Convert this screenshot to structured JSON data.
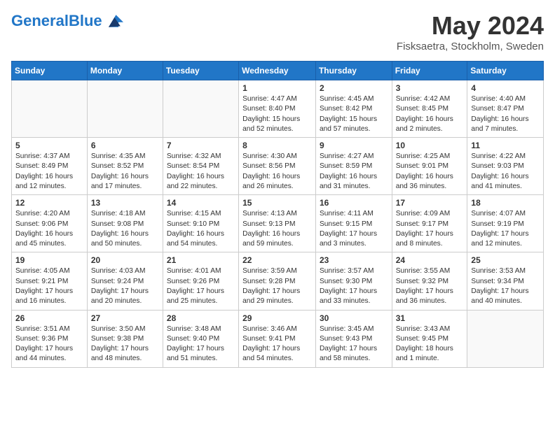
{
  "header": {
    "logo_line1": "General",
    "logo_line2": "Blue",
    "month": "May 2024",
    "location": "Fisksaetra, Stockholm, Sweden"
  },
  "days_of_week": [
    "Sunday",
    "Monday",
    "Tuesday",
    "Wednesday",
    "Thursday",
    "Friday",
    "Saturday"
  ],
  "weeks": [
    [
      {
        "num": "",
        "text": ""
      },
      {
        "num": "",
        "text": ""
      },
      {
        "num": "",
        "text": ""
      },
      {
        "num": "1",
        "text": "Sunrise: 4:47 AM\nSunset: 8:40 PM\nDaylight: 15 hours and 52 minutes."
      },
      {
        "num": "2",
        "text": "Sunrise: 4:45 AM\nSunset: 8:42 PM\nDaylight: 15 hours and 57 minutes."
      },
      {
        "num": "3",
        "text": "Sunrise: 4:42 AM\nSunset: 8:45 PM\nDaylight: 16 hours and 2 minutes."
      },
      {
        "num": "4",
        "text": "Sunrise: 4:40 AM\nSunset: 8:47 PM\nDaylight: 16 hours and 7 minutes."
      }
    ],
    [
      {
        "num": "5",
        "text": "Sunrise: 4:37 AM\nSunset: 8:49 PM\nDaylight: 16 hours and 12 minutes."
      },
      {
        "num": "6",
        "text": "Sunrise: 4:35 AM\nSunset: 8:52 PM\nDaylight: 16 hours and 17 minutes."
      },
      {
        "num": "7",
        "text": "Sunrise: 4:32 AM\nSunset: 8:54 PM\nDaylight: 16 hours and 22 minutes."
      },
      {
        "num": "8",
        "text": "Sunrise: 4:30 AM\nSunset: 8:56 PM\nDaylight: 16 hours and 26 minutes."
      },
      {
        "num": "9",
        "text": "Sunrise: 4:27 AM\nSunset: 8:59 PM\nDaylight: 16 hours and 31 minutes."
      },
      {
        "num": "10",
        "text": "Sunrise: 4:25 AM\nSunset: 9:01 PM\nDaylight: 16 hours and 36 minutes."
      },
      {
        "num": "11",
        "text": "Sunrise: 4:22 AM\nSunset: 9:03 PM\nDaylight: 16 hours and 41 minutes."
      }
    ],
    [
      {
        "num": "12",
        "text": "Sunrise: 4:20 AM\nSunset: 9:06 PM\nDaylight: 16 hours and 45 minutes."
      },
      {
        "num": "13",
        "text": "Sunrise: 4:18 AM\nSunset: 9:08 PM\nDaylight: 16 hours and 50 minutes."
      },
      {
        "num": "14",
        "text": "Sunrise: 4:15 AM\nSunset: 9:10 PM\nDaylight: 16 hours and 54 minutes."
      },
      {
        "num": "15",
        "text": "Sunrise: 4:13 AM\nSunset: 9:13 PM\nDaylight: 16 hours and 59 minutes."
      },
      {
        "num": "16",
        "text": "Sunrise: 4:11 AM\nSunset: 9:15 PM\nDaylight: 17 hours and 3 minutes."
      },
      {
        "num": "17",
        "text": "Sunrise: 4:09 AM\nSunset: 9:17 PM\nDaylight: 17 hours and 8 minutes."
      },
      {
        "num": "18",
        "text": "Sunrise: 4:07 AM\nSunset: 9:19 PM\nDaylight: 17 hours and 12 minutes."
      }
    ],
    [
      {
        "num": "19",
        "text": "Sunrise: 4:05 AM\nSunset: 9:21 PM\nDaylight: 17 hours and 16 minutes."
      },
      {
        "num": "20",
        "text": "Sunrise: 4:03 AM\nSunset: 9:24 PM\nDaylight: 17 hours and 20 minutes."
      },
      {
        "num": "21",
        "text": "Sunrise: 4:01 AM\nSunset: 9:26 PM\nDaylight: 17 hours and 25 minutes."
      },
      {
        "num": "22",
        "text": "Sunrise: 3:59 AM\nSunset: 9:28 PM\nDaylight: 17 hours and 29 minutes."
      },
      {
        "num": "23",
        "text": "Sunrise: 3:57 AM\nSunset: 9:30 PM\nDaylight: 17 hours and 33 minutes."
      },
      {
        "num": "24",
        "text": "Sunrise: 3:55 AM\nSunset: 9:32 PM\nDaylight: 17 hours and 36 minutes."
      },
      {
        "num": "25",
        "text": "Sunrise: 3:53 AM\nSunset: 9:34 PM\nDaylight: 17 hours and 40 minutes."
      }
    ],
    [
      {
        "num": "26",
        "text": "Sunrise: 3:51 AM\nSunset: 9:36 PM\nDaylight: 17 hours and 44 minutes."
      },
      {
        "num": "27",
        "text": "Sunrise: 3:50 AM\nSunset: 9:38 PM\nDaylight: 17 hours and 48 minutes."
      },
      {
        "num": "28",
        "text": "Sunrise: 3:48 AM\nSunset: 9:40 PM\nDaylight: 17 hours and 51 minutes."
      },
      {
        "num": "29",
        "text": "Sunrise: 3:46 AM\nSunset: 9:41 PM\nDaylight: 17 hours and 54 minutes."
      },
      {
        "num": "30",
        "text": "Sunrise: 3:45 AM\nSunset: 9:43 PM\nDaylight: 17 hours and 58 minutes."
      },
      {
        "num": "31",
        "text": "Sunrise: 3:43 AM\nSunset: 9:45 PM\nDaylight: 18 hours and 1 minute."
      },
      {
        "num": "",
        "text": ""
      }
    ]
  ]
}
